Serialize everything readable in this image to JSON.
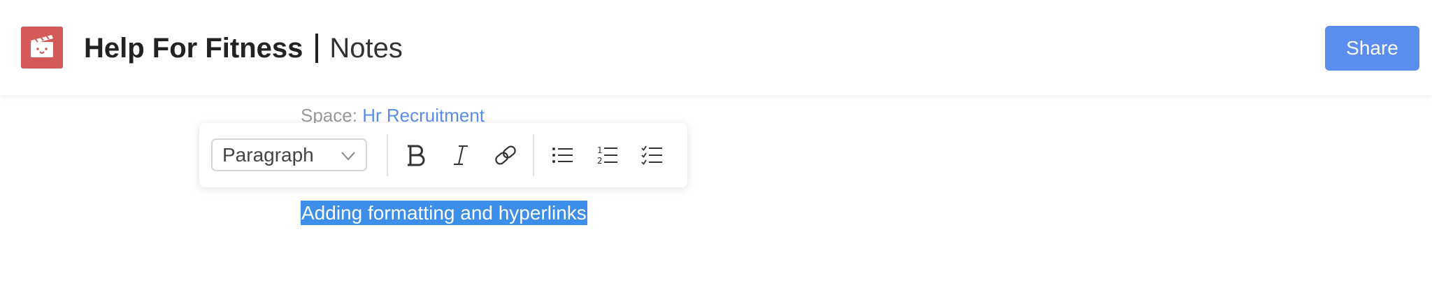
{
  "header": {
    "app_name": "Help For Fitness",
    "section": "Notes",
    "share_label": "Share"
  },
  "space": {
    "label": "Space:",
    "value": "Hr Recruitment"
  },
  "toolbar": {
    "block_format": "Paragraph",
    "buttons": [
      "bold-icon",
      "italic-icon",
      "link-icon",
      "bulleted-list-icon",
      "numbered-list-icon",
      "checklist-icon"
    ]
  },
  "editor": {
    "selected_text": "Adding formatting and hyperlinks"
  },
  "colors": {
    "brand_logo": "#d45a5a",
    "accent": "#5b8def",
    "selection": "#3d8ee9"
  }
}
